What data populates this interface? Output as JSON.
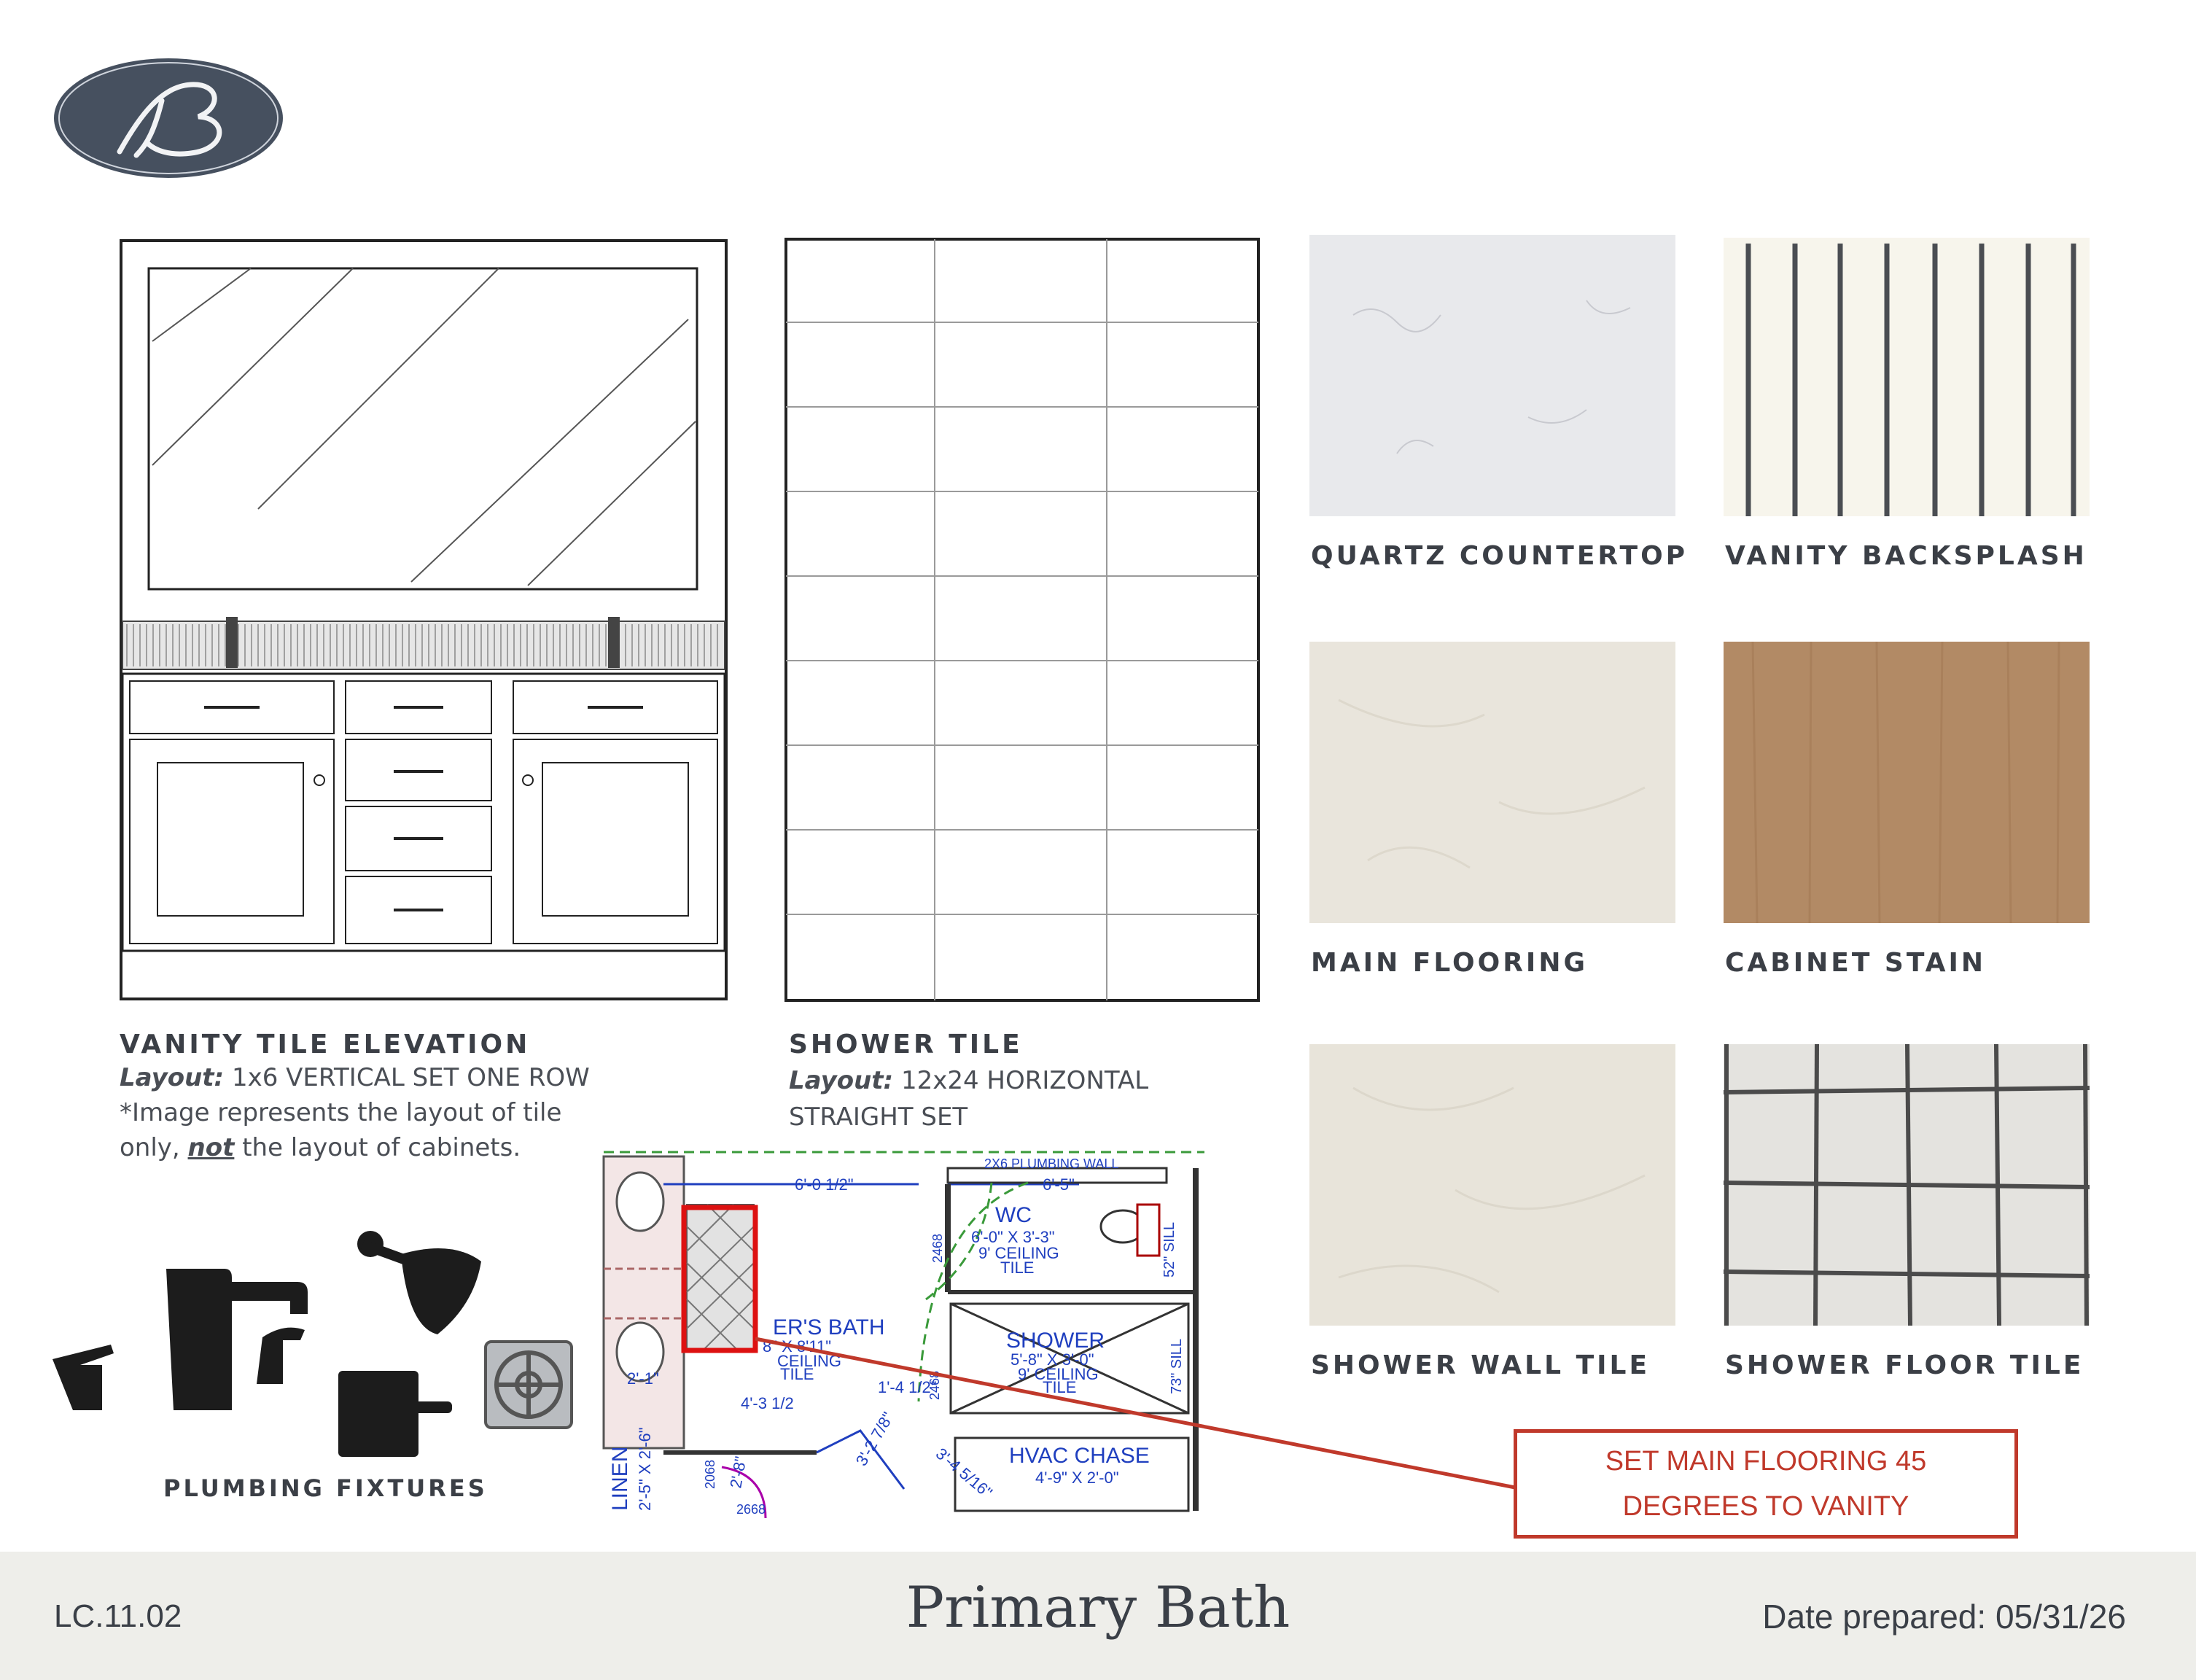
{
  "logo": {
    "letter": "B"
  },
  "vanity": {
    "title": "VANITY TILE ELEVATION",
    "layout_label": "Layout:",
    "layout_value": "1x6 VERTICAL SET ONE ROW",
    "note_line1": "*Image represents the layout of tile",
    "note_only": "only,",
    "note_not": "not",
    "note_rest": "the layout of cabinets."
  },
  "shower": {
    "title": "SHOWER TILE",
    "layout_label": "Layout:",
    "layout_value": "12x24 HORIZONTAL",
    "layout_value2": "STRAIGHT SET"
  },
  "swatches": [
    {
      "label": "QUARTZ COUNTERTOP",
      "color": "#e8e9ec"
    },
    {
      "label": "VANITY BACKSPLASH",
      "color": "#f7f5ec"
    },
    {
      "label": "MAIN FLOORING",
      "color": "#e9e5dc"
    },
    {
      "label": "CABINET STAIN",
      "color": "#b28a65"
    },
    {
      "label": "SHOWER WALL TILE",
      "color": "#e8e4da"
    },
    {
      "label": "SHOWER FLOOR TILE",
      "color": "#e4e3df"
    }
  ],
  "plumbing": {
    "label": "PLUMBING FIXTURES"
  },
  "floorplan": {
    "plumbing_wall": "2X6 PLUMBING WALL",
    "dim_6_0": "6'-0 1/2\"",
    "dim_6_5": "6'-5\"",
    "wc": "WC",
    "wc_size": "6'-0\" X 3'-3\"",
    "wc_ceiling": "9' CEILING",
    "wc_tile": "TILE",
    "dim_2468": "2468",
    "sill52": "52\" SILL",
    "bath": "ER'S BATH",
    "bath_size": "8\" X 8'11\"",
    "bath_ceiling": "CEILING",
    "bath_tile": "TILE",
    "shower": "SHOWER",
    "shower_size": "5'-8\" X 3'-0\"",
    "shower_ceiling": "9' CEILING",
    "shower_tile": "TILE",
    "sill73": "73\" SILL",
    "dim_2_1": "2'-1\"",
    "dim_4_3": "4'-3 1/2",
    "dim_1_4": "1'-4 1/2\"",
    "dim_3_2": "3'-2 7/8\"",
    "dim_3_4": "3'-4 5/16\"",
    "dim_2468b": "2468",
    "dim_2068": "2068",
    "dim_2_8": "2'-8\"",
    "dim_2668": "2668",
    "linen": "LINEN",
    "linen_size": "2'-5\" X 2'-6\"",
    "hvac": "HVAC CHASE",
    "hvac_size": "4'-9\" X 2'-0\""
  },
  "callout": {
    "line1": "SET MAIN FLOORING 45",
    "line2": "DEGREES TO VANITY"
  },
  "footer": {
    "code": "LC.11.02",
    "title": "Primary Bath",
    "date": "Date prepared: 05/31/26"
  },
  "colors": {
    "navy": "#3e4858",
    "accent_red": "#c0392b",
    "plan_blue": "#1f3fbf"
  }
}
